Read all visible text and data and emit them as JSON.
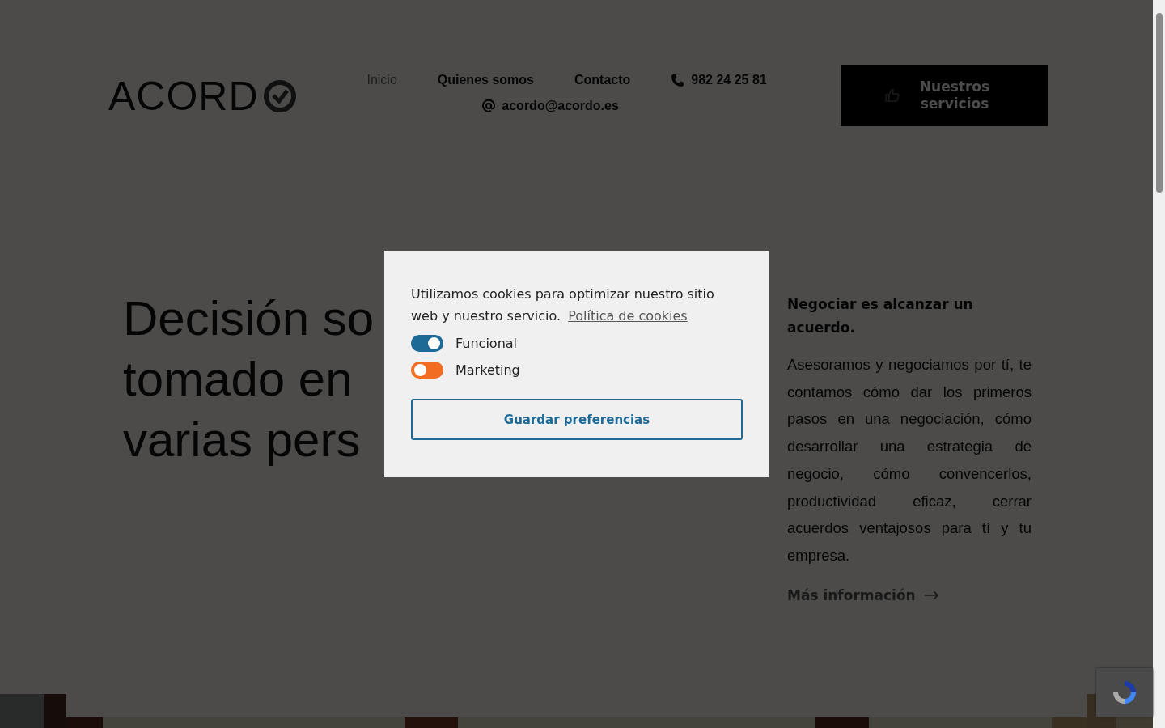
{
  "logo": {
    "text": "ACORD"
  },
  "nav": [
    {
      "label": "Inicio",
      "selected": true
    },
    {
      "label": "Quienes somos",
      "selected": false
    },
    {
      "label": "Contacto",
      "selected": false
    }
  ],
  "phone": "982 24 25 81",
  "email": "acordo@acordo.es",
  "cta_button": "Nuestros servicios",
  "hero": {
    "heading_lines": [
      "Decisión so",
      "tomado en",
      "varias pers"
    ]
  },
  "aside": {
    "title": "Negociar es alcanzar un acuerdo.",
    "text": "Asesoramos y negociamos por tí, te contamos cómo dar los primeros pasos en una negociación, cómo desarrollar una estrategia de negocio, cómo convencerlos, productividad eficaz, cerrar acuerdos ventajosos para tí y tu empresa.",
    "link": "Más información"
  },
  "cookie_dialog": {
    "message": "Utilizamos cookies para optimizar nuestro sitio web y nuestro servicio.",
    "policy_link": "Política de cookies",
    "options": [
      {
        "label": "Funcional",
        "on": true
      },
      {
        "label": "Marketing",
        "on": false
      }
    ],
    "save_button": "Guardar preferencias"
  }
}
